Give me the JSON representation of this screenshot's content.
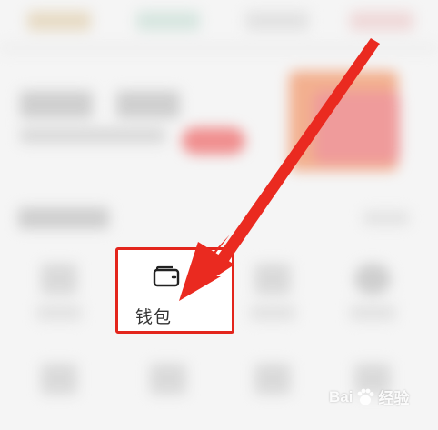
{
  "wallet": {
    "label": "钱包",
    "icon": "wallet-icon"
  },
  "watermark": {
    "brand": "Bai",
    "suffix": "经验",
    "icon": "paw-icon"
  },
  "colors": {
    "highlight": "#e3251c",
    "arrow": "#ea2a20",
    "text": "#333333"
  }
}
